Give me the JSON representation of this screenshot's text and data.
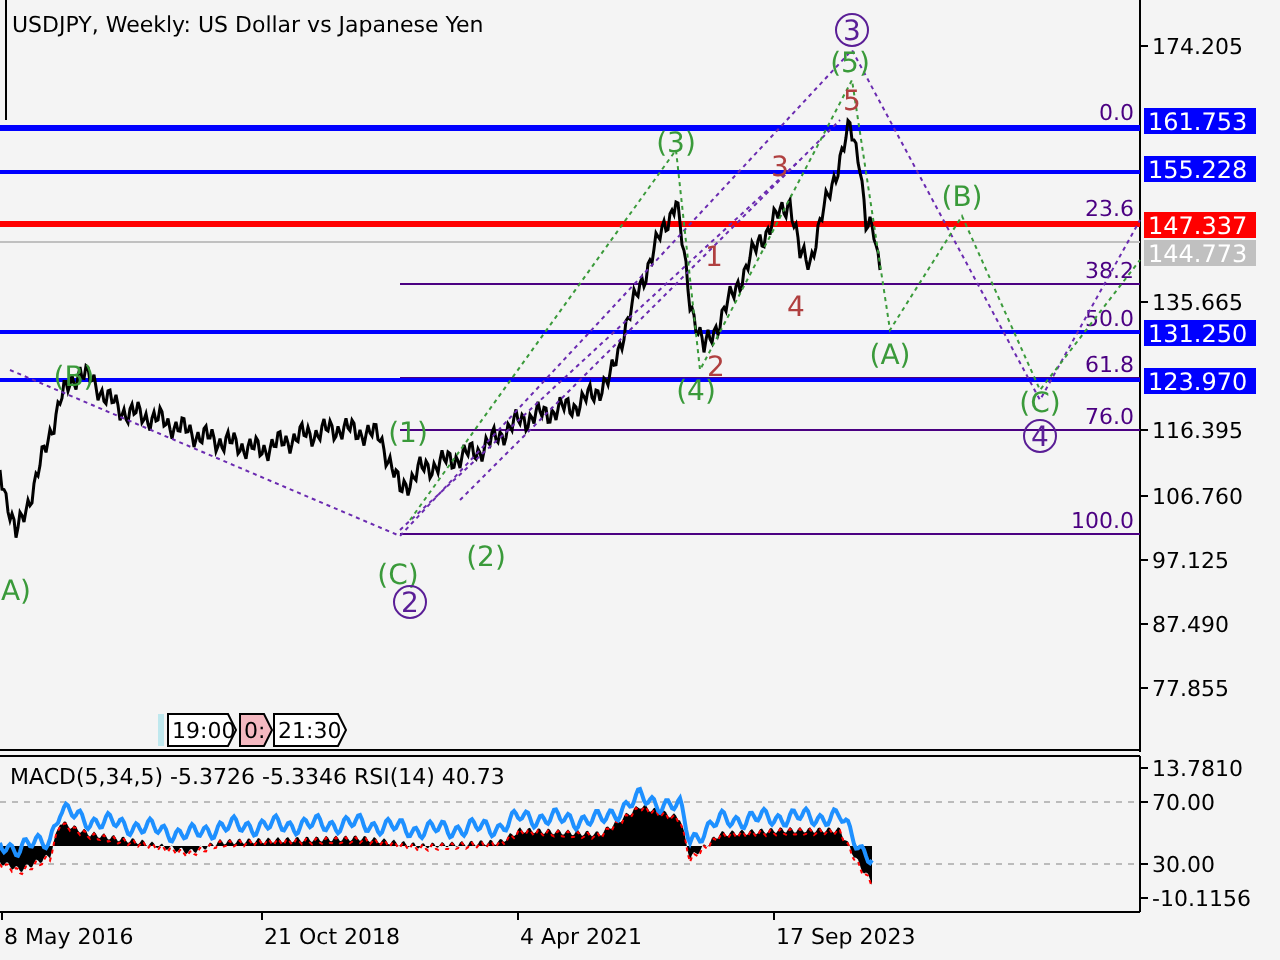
{
  "title": "USDJPY, Weekly:  US Dollar vs Japanese Yen",
  "price_axis": [
    "174.205",
    "135.665",
    "116.395",
    "106.760",
    "97.125",
    "87.490",
    "77.855"
  ],
  "price_tags": [
    {
      "text": "161.753",
      "color": "#0000ff"
    },
    {
      "text": "155.228",
      "color": "#0000ff"
    },
    {
      "text": "147.337",
      "color": "#ff0000"
    },
    {
      "text": "144.773",
      "color": "#c0c0c0"
    },
    {
      "text": "131.250",
      "color": "#0000ff"
    },
    {
      "text": "123.970",
      "color": "#0000ff"
    }
  ],
  "fib_levels": [
    "0.0",
    "23.6",
    "38.2",
    "50.0",
    "61.8",
    "76.0",
    "100.0"
  ],
  "wave_labels": [
    {
      "text": "(B)",
      "kind": "plain",
      "color": "#3a9a3a"
    },
    {
      "text": "A)",
      "kind": "plain",
      "color": "#3a9a3a"
    },
    {
      "text": "(1)",
      "kind": "plain",
      "color": "#3a9a3a"
    },
    {
      "text": "(2)",
      "kind": "plain",
      "color": "#3a9a3a"
    },
    {
      "text": "(C)",
      "kind": "plain",
      "color": "#3a9a3a"
    },
    {
      "text": "2",
      "kind": "circled",
      "color": "#5a1e96"
    },
    {
      "text": "(3)",
      "kind": "plain",
      "color": "#3a9a3a"
    },
    {
      "text": "(4)",
      "kind": "plain",
      "color": "#3a9a3a"
    },
    {
      "text": "1",
      "kind": "plain",
      "color": "#b04040"
    },
    {
      "text": "2",
      "kind": "plain",
      "color": "#b04040"
    },
    {
      "text": "3",
      "kind": "plain",
      "color": "#b04040"
    },
    {
      "text": "4",
      "kind": "plain",
      "color": "#b04040"
    },
    {
      "text": "3",
      "kind": "circled",
      "color": "#5a1e96"
    },
    {
      "text": "(5)",
      "kind": "plain",
      "color": "#3a9a3a"
    },
    {
      "text": "5",
      "kind": "plain",
      "color": "#b04040"
    },
    {
      "text": "(B)",
      "kind": "plain",
      "color": "#3a9a3a"
    },
    {
      "text": "(A)",
      "kind": "plain",
      "color": "#3a9a3a"
    },
    {
      "text": "(C)",
      "kind": "plain",
      "color": "#3a9a3a"
    },
    {
      "text": "4",
      "kind": "circled",
      "color": "#5a1e96"
    }
  ],
  "time_markers": [
    {
      "text": "19:00",
      "color": "#ffffff"
    },
    {
      "text": "0:",
      "color": "#f4b8c0"
    },
    {
      "text": "21:30",
      "color": "#ffffff"
    }
  ],
  "indicator": {
    "label": "MACD(5,34,5) -5.3726 -5.3346 RSI(14) 40.73",
    "axis": [
      "13.7810",
      "70.00",
      "30.00",
      "-10.1156"
    ]
  },
  "time_axis": [
    "8 May 2016",
    "21 Oct 2018",
    "4 Apr 2021",
    "17 Sep 2023"
  ]
}
